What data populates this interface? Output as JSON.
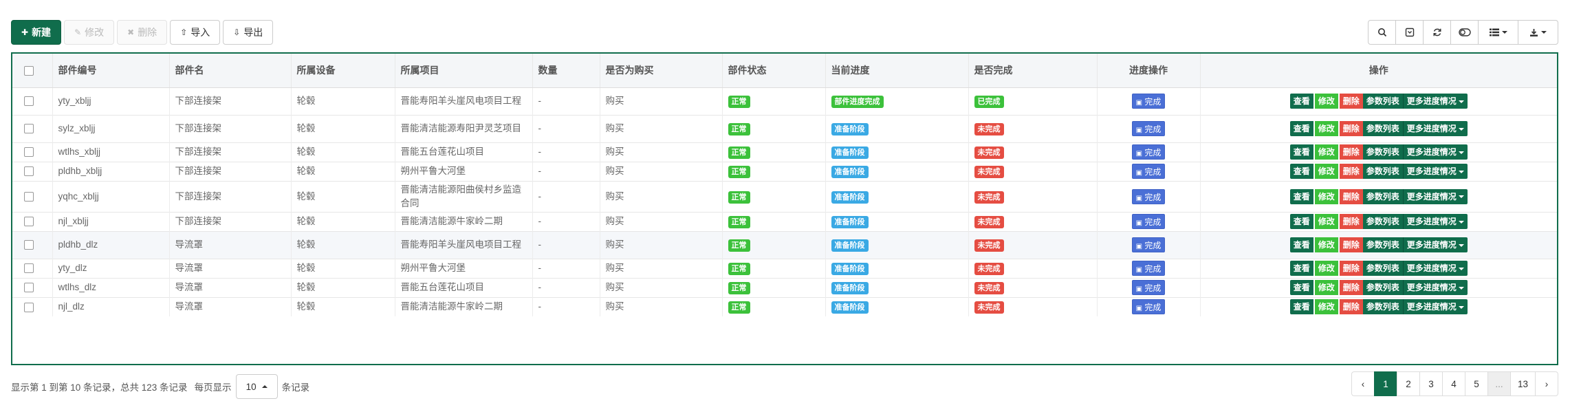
{
  "toolbar": {
    "new_label": "新建",
    "edit_label": "修改",
    "delete_label": "删除",
    "import_label": "导入",
    "export_label": "导出"
  },
  "right_tools": [
    "search-icon",
    "toggle-pane-icon",
    "refresh-icon",
    "toggle-view-icon",
    "columns-icon",
    "export-icon"
  ],
  "table": {
    "headers": [
      "部件编号",
      "部件名",
      "所属设备",
      "所属项目",
      "数量",
      "是否为购买",
      "部件状态",
      "当前进度",
      "是否完成",
      "进度操作",
      "操作"
    ],
    "rows": [
      {
        "code": "yty_xbljj",
        "name": "下部连接架",
        "device": "轮毂",
        "project": "晋能寿阳羊头崖风电项目工程",
        "qty": "-",
        "purchase": "购买",
        "status": "正常",
        "progress": "部件进度完成",
        "done": "已完成",
        "progress_color": "green",
        "done_color": "green"
      },
      {
        "code": "sylz_xbljj",
        "name": "下部连接架",
        "device": "轮毂",
        "project": "晋能清洁能源寿阳尹灵芝项目",
        "qty": "-",
        "purchase": "购买",
        "status": "正常",
        "progress": "准备阶段",
        "done": "未完成",
        "progress_color": "blue",
        "done_color": "red"
      },
      {
        "code": "wtlhs_xbljj",
        "name": "下部连接架",
        "device": "轮毂",
        "project": "晋能五台莲花山项目",
        "qty": "-",
        "purchase": "购买",
        "status": "正常",
        "progress": "准备阶段",
        "done": "未完成",
        "progress_color": "blue",
        "done_color": "red"
      },
      {
        "code": "pldhb_xbljj",
        "name": "下部连接架",
        "device": "轮毂",
        "project": "朔州平鲁大河堡",
        "qty": "-",
        "purchase": "购买",
        "status": "正常",
        "progress": "准备阶段",
        "done": "未完成",
        "progress_color": "blue",
        "done_color": "red"
      },
      {
        "code": "yqhc_xbljj",
        "name": "下部连接架",
        "device": "轮毂",
        "project": "晋能清洁能源阳曲侯村乡监造合同",
        "qty": "-",
        "purchase": "购买",
        "status": "正常",
        "progress": "准备阶段",
        "done": "未完成",
        "progress_color": "blue",
        "done_color": "red"
      },
      {
        "code": "njl_xbljj",
        "name": "下部连接架",
        "device": "轮毂",
        "project": "晋能清洁能源牛家岭二期",
        "qty": "-",
        "purchase": "购买",
        "status": "正常",
        "progress": "准备阶段",
        "done": "未完成",
        "progress_color": "blue",
        "done_color": "red"
      },
      {
        "code": "pldhb_dlz",
        "name": "导流罩",
        "device": "轮毂",
        "project": "晋能寿阳羊头崖风电项目工程",
        "qty": "-",
        "purchase": "购买",
        "status": "正常",
        "progress": "准备阶段",
        "done": "未完成",
        "progress_color": "blue",
        "done_color": "red"
      },
      {
        "code": "yty_dlz",
        "name": "导流罩",
        "device": "轮毂",
        "project": "朔州平鲁大河堡",
        "qty": "-",
        "purchase": "购买",
        "status": "正常",
        "progress": "准备阶段",
        "done": "未完成",
        "progress_color": "blue",
        "done_color": "red"
      },
      {
        "code": "wtlhs_dlz",
        "name": "导流罩",
        "device": "轮毂",
        "project": "晋能五台莲花山项目",
        "qty": "-",
        "purchase": "购买",
        "status": "正常",
        "progress": "准备阶段",
        "done": "未完成",
        "progress_color": "blue",
        "done_color": "red"
      },
      {
        "code": "njl_dlz",
        "name": "导流罩",
        "device": "轮毂",
        "project": "晋能清洁能源牛家岭二期",
        "qty": "-",
        "purchase": "购买",
        "status": "正常",
        "progress": "准备阶段",
        "done": "未完成",
        "progress_color": "blue",
        "done_color": "red"
      }
    ],
    "progress_op_label": "完成",
    "row_ops": {
      "view": "查看",
      "edit": "修改",
      "delete": "删除",
      "params": "参数列表",
      "more": "更多进度情况"
    }
  },
  "footer": {
    "info": "显示第 1 到第 10 条记录，总共 123 条记录",
    "per_page_prefix": "每页显示",
    "page_size": "10",
    "per_page_suffix": "条记录"
  },
  "pagination": {
    "prev": "‹",
    "pages": [
      "1",
      "2",
      "3",
      "4",
      "5",
      "...",
      "13"
    ],
    "current": "1",
    "next": "›"
  },
  "colors": {
    "primary": "#106d4c",
    "success": "#3cc13b",
    "info": "#3aa9e4",
    "danger": "#e54d42",
    "progress_button": "#4a6fd6"
  }
}
